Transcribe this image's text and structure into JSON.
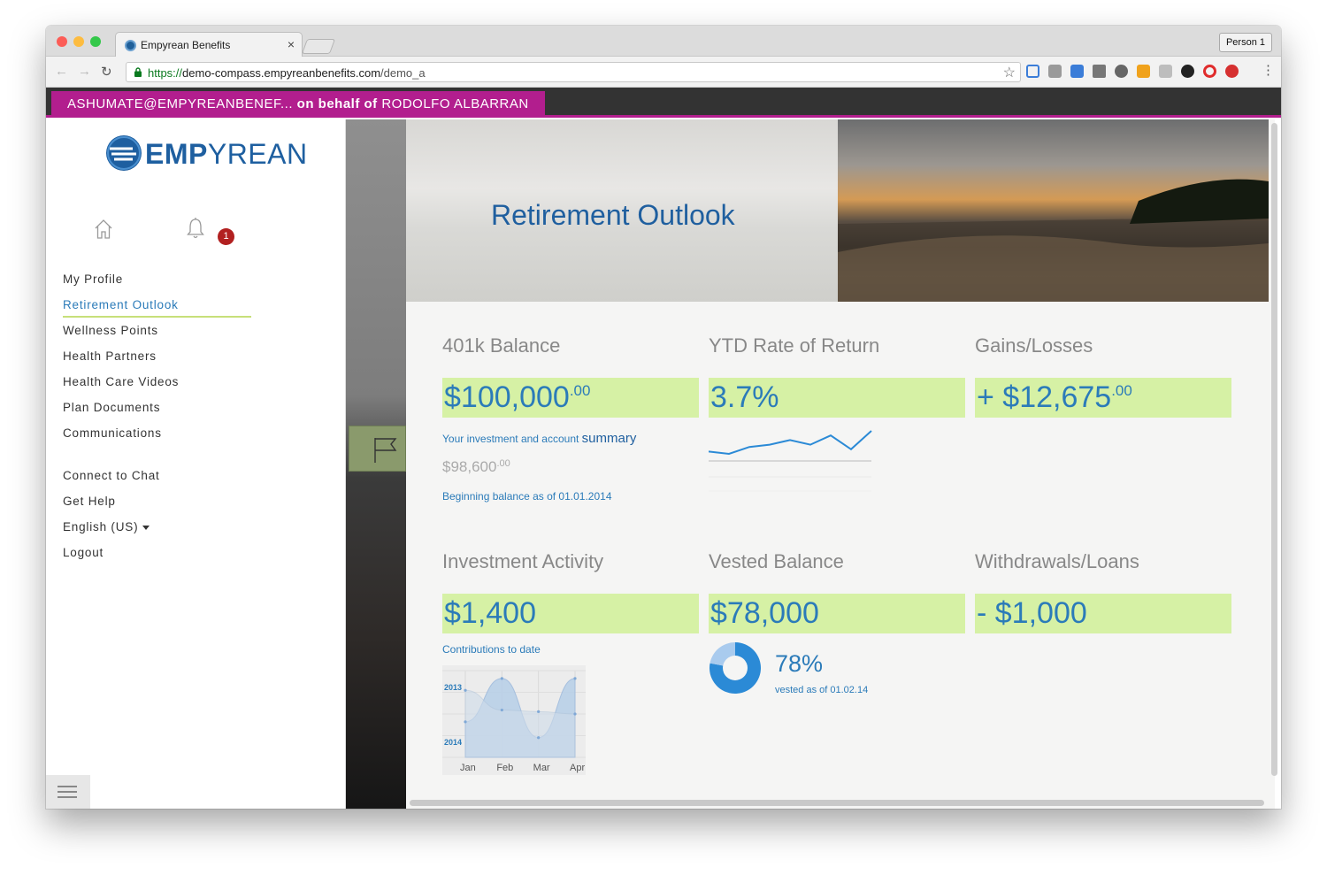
{
  "browser": {
    "tab_title": "Empyrean Benefits",
    "tab_close": "×",
    "person_label": "Person 1",
    "url_scheme": "https://",
    "url_host": "demo-compass.empyreanbenefits.com",
    "url_path": "/demo_a"
  },
  "impersonation": {
    "user": "ASHUMATE@EMPYREANBENEF...",
    "on_behalf_text": "on behalf of",
    "target": "RODOLFO ALBARRAN"
  },
  "brand": {
    "logo_bold": "EMP",
    "logo_rest": "YREAN",
    "primary_color": "#1e5fa0",
    "highlight_color": "#d6f1a5",
    "impersonation_color": "#b21e8e"
  },
  "sidebar": {
    "notification_count": "1",
    "menu": [
      {
        "label": "My Profile"
      },
      {
        "label": "Retirement Outlook",
        "active": true
      },
      {
        "label": "Wellness Points"
      },
      {
        "label": "Health Partners"
      },
      {
        "label": "Health Care Videos"
      },
      {
        "label": "Plan Documents"
      },
      {
        "label": "Communications"
      }
    ],
    "secondary": [
      {
        "label": "Connect to Chat"
      },
      {
        "label": "Get Help"
      },
      {
        "label": "English (US)"
      },
      {
        "label": "Logout"
      }
    ]
  },
  "hero": {
    "title": "Retirement Outlook"
  },
  "cards": {
    "balance": {
      "title": "401k Balance",
      "value": "$100,000",
      "cents": ".00",
      "note_prefix": "Your investment and account",
      "note_link": "summary",
      "beginning_value": "$98,600",
      "beginning_cents": ".00",
      "beginning_note": "Beginning balance as of 01.01.2014"
    },
    "ytd": {
      "title": "YTD Rate of Return",
      "value": "3.7%"
    },
    "gains": {
      "title": "Gains/Losses",
      "value": "+ $12,675",
      "cents": ".00"
    },
    "activity": {
      "title": "Investment Activity",
      "value": "$1,400",
      "note": "Contributions to date"
    },
    "vested": {
      "title": "Vested Balance",
      "value": "$78,000",
      "percent": "78%",
      "note": "vested as of 01.02.14"
    },
    "withdrawals": {
      "title": "Withdrawals/Loans",
      "value": "- $1,000"
    }
  },
  "chart_data": [
    {
      "type": "line",
      "title": "",
      "x": [
        1,
        2,
        3,
        4,
        5,
        6,
        7,
        8,
        9
      ],
      "values": [
        2,
        1,
        4,
        5,
        7,
        5,
        9,
        3,
        11
      ],
      "color": "#2b8ad6"
    },
    {
      "type": "area",
      "x_labels": [
        "Jan",
        "Feb",
        "Mar",
        "Apr"
      ],
      "series_labels": [
        "2013",
        "2014"
      ],
      "series": [
        {
          "values": [
            45,
            100,
            25,
            100
          ]
        },
        {
          "values": [
            85,
            60,
            58,
            55
          ]
        }
      ],
      "ylim": [
        0,
        110
      ],
      "color": "#a9c8ea"
    },
    {
      "type": "pie",
      "values": [
        78,
        22
      ],
      "colors": [
        "#2b8ad6",
        "#a9cbee"
      ]
    }
  ]
}
